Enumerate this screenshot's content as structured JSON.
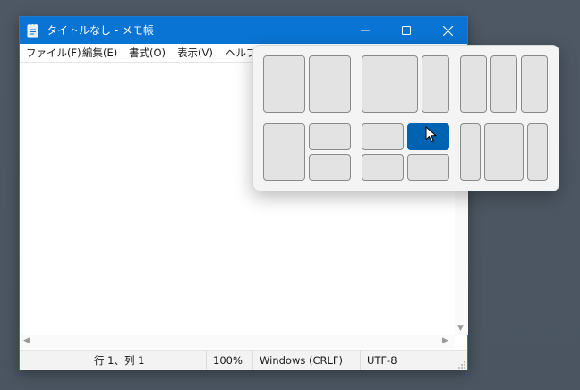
{
  "window": {
    "title": "タイトルなし - メモ帳",
    "accent_color": "#0a74d4"
  },
  "menu": {
    "items": [
      "ファイル(F)",
      "編集(E)",
      "書式(O)",
      "表示(V)",
      "ヘルプ("
    ]
  },
  "status": {
    "position": "行 1、列 1",
    "zoom": "100%",
    "line_ending": "Windows (CRLF)",
    "encoding": "UTF-8"
  },
  "snap_layouts": {
    "highlight_color": "#0063b1",
    "layouts": [
      {
        "name": "two-equal",
        "zones": 2
      },
      {
        "name": "two-wide-narrow",
        "zones": 2
      },
      {
        "name": "three-columns",
        "zones": 3
      },
      {
        "name": "one-left-two-right",
        "zones": 3
      },
      {
        "name": "four-quadrants",
        "zones": 4,
        "active_zone": "top-right"
      },
      {
        "name": "narrow-wide-narrow",
        "zones": 3
      }
    ]
  },
  "icons": [
    "notepad-icon",
    "minimize-icon",
    "maximize-icon",
    "close-icon",
    "mouse-cursor-icon"
  ]
}
